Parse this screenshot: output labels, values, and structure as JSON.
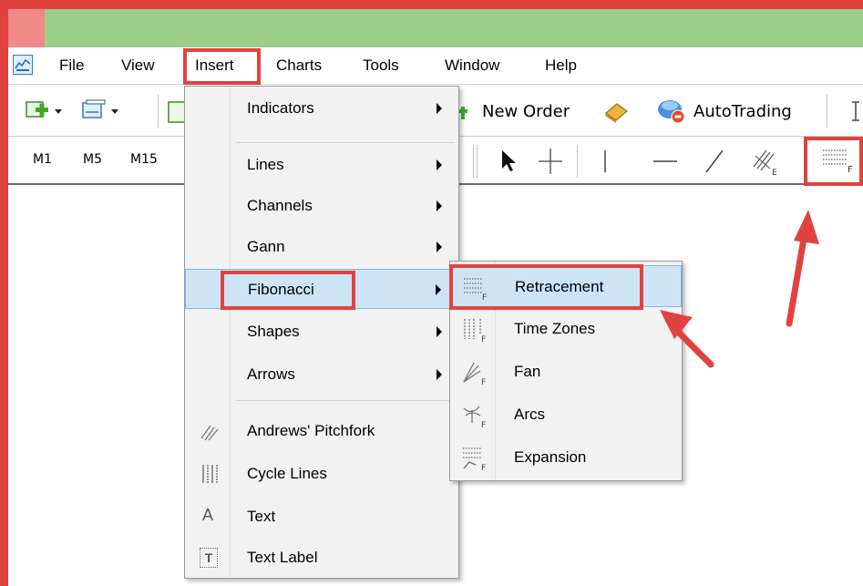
{
  "menubar": {
    "items": [
      {
        "label": "File"
      },
      {
        "label": "View"
      },
      {
        "label": "Insert"
      },
      {
        "label": "Charts"
      },
      {
        "label": "Tools"
      },
      {
        "label": "Window"
      },
      {
        "label": "Help"
      }
    ]
  },
  "toolbar": {
    "new_order_label": "New Order",
    "autotrading_label": "AutoTrading"
  },
  "timeframes": [
    "M1",
    "M5",
    "M15"
  ],
  "insert_menu": {
    "items": [
      {
        "label": "Indicators",
        "submenu": true
      },
      {
        "label": "Lines",
        "submenu": true
      },
      {
        "label": "Channels",
        "submenu": true
      },
      {
        "label": "Gann",
        "submenu": true
      },
      {
        "label": "Fibonacci",
        "submenu": true,
        "highlighted": true
      },
      {
        "label": "Shapes",
        "submenu": true
      },
      {
        "label": "Arrows",
        "submenu": true
      },
      {
        "label": "Andrews' Pitchfork",
        "icon": "pitchfork-icon"
      },
      {
        "label": "Cycle Lines",
        "icon": "cycle-lines-icon"
      },
      {
        "label": "Text",
        "icon": "text-icon",
        "icon_glyph": "A"
      },
      {
        "label": "Text Label",
        "icon": "text-label-icon",
        "icon_glyph": "T"
      }
    ]
  },
  "fibonacci_submenu": {
    "items": [
      {
        "label": "Retracement",
        "icon": "fibo-retracement-icon",
        "highlighted": true
      },
      {
        "label": "Time Zones",
        "icon": "fibo-timezones-icon"
      },
      {
        "label": "Fan",
        "icon": "fibo-fan-icon"
      },
      {
        "label": "Arcs",
        "icon": "fibo-arcs-icon"
      },
      {
        "label": "Expansion",
        "icon": "fibo-expansion-icon"
      }
    ]
  },
  "icon_letters": {
    "fibo": "F",
    "equidistant": "E"
  },
  "colors": {
    "highlight_border": "#e0433f",
    "titlebar": "#9bcf8a",
    "menu_highlight": "#cde4f7"
  }
}
